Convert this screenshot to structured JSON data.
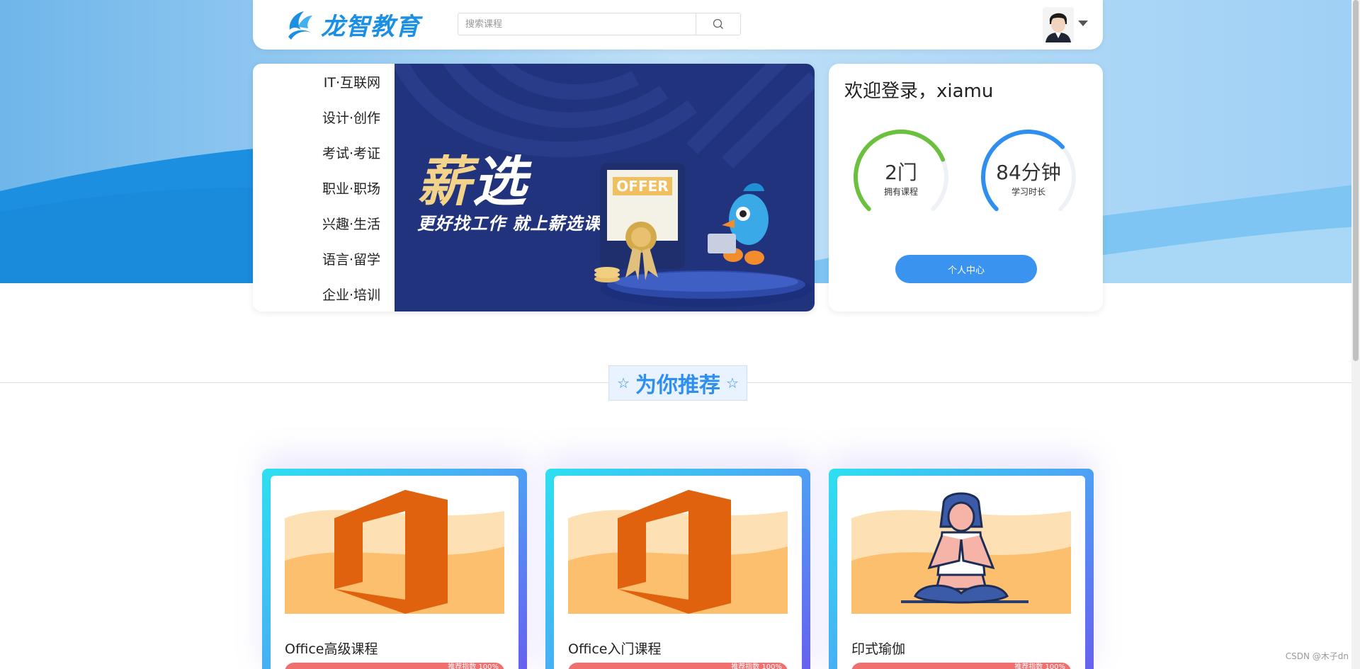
{
  "header": {
    "logo_text": "龙智教育",
    "search_placeholder": "搜索课程",
    "search_icon": "search-icon",
    "avatar_icon": "user-avatar",
    "menu_icon": "caret-down-icon"
  },
  "categories": [
    {
      "label": "IT·互联网"
    },
    {
      "label": "设计·创作"
    },
    {
      "label": "考试·考证"
    },
    {
      "label": "职业·职场"
    },
    {
      "label": "兴趣·生活"
    },
    {
      "label": "语言·留学"
    },
    {
      "label": "企业·培训"
    }
  ],
  "banner": {
    "title_first": "薪",
    "title_rest": "选",
    "subtitle": "更好找工作 就上薪选课",
    "offer_text": "OFFER"
  },
  "login": {
    "welcome": "欢迎登录，xiamu",
    "stats": [
      {
        "value": "2门",
        "label": "拥有课程",
        "fraction": 0.75,
        "color": "#6bc13d"
      },
      {
        "value": "84分钟",
        "label": "学习时长",
        "fraction": 0.68,
        "color": "#2f8ff0"
      }
    ],
    "personal_button": "个人中心"
  },
  "section": {
    "title": "为你推荐",
    "star_icon": "star-outline-icon"
  },
  "courses": [
    {
      "name": "Office高级课程",
      "rating": "推荐指数 100%",
      "image_icon": "office-icon"
    },
    {
      "name": "Office入门课程",
      "rating": "推荐指数 100%",
      "image_icon": "office-icon"
    },
    {
      "name": "印式瑜伽",
      "rating": "推荐指数 100%",
      "image_icon": "yoga-icon"
    }
  ],
  "watermark": "CSDN @木子dn",
  "colors": {
    "brand": "#1a8fe3",
    "banner_bg": "#22337e",
    "accent_blue": "#2f8ff0",
    "rating_red": "#f07070"
  }
}
